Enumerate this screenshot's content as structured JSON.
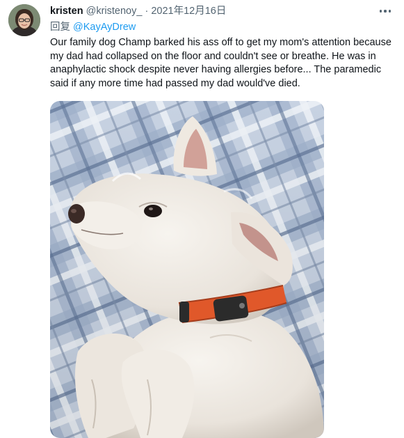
{
  "tweet": {
    "author_name": "kristen",
    "author_handle": "@kristenoy_",
    "separator": "·",
    "timestamp": "2021年12月16日",
    "reply_prefix": "回复",
    "reply_to": "@KayAyDrew",
    "text": "Our family dog Champ barked his ass off to get my mom's attention because my dad had collapsed on the floor and couldn't see or breathe. He was in anaphylactic shock despite never having allergies before... The paramedic said if any more time had passed my dad would've died."
  },
  "icons": {
    "more": "more-horizontal-icon"
  },
  "colors": {
    "link": "#1d9bf0",
    "secondary_text": "#536471",
    "primary_text": "#0f1419",
    "collar": "#e0582a"
  }
}
